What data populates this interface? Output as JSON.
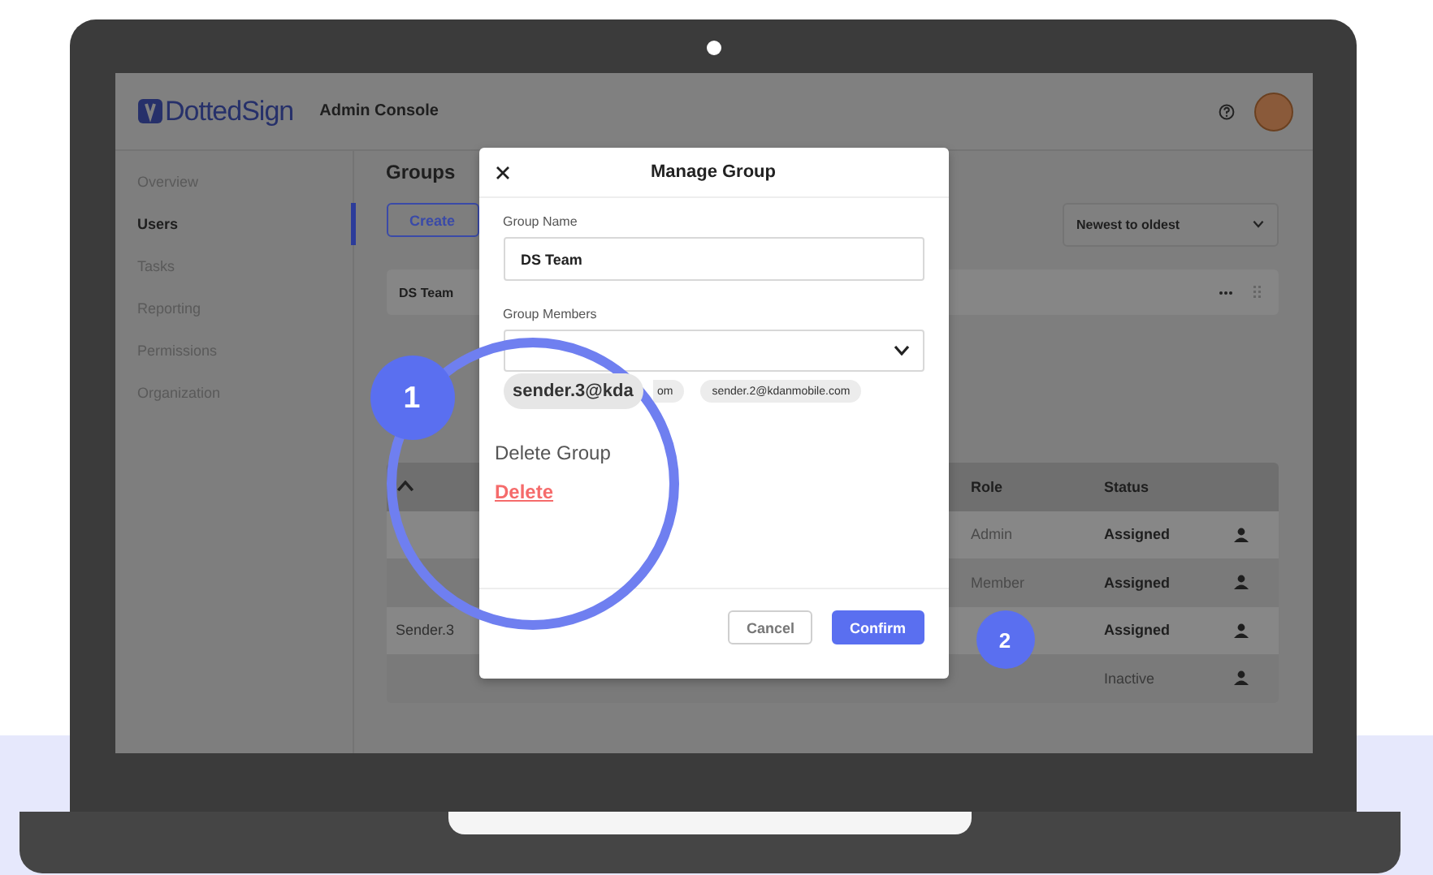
{
  "header": {
    "logo": "DottedSign",
    "title": "Admin Console"
  },
  "sidebar": {
    "items": [
      {
        "label": "Overview",
        "selected": false
      },
      {
        "label": "Users",
        "selected": true
      },
      {
        "label": "Tasks",
        "selected": false
      },
      {
        "label": "Reporting",
        "selected": false
      },
      {
        "label": "Permissions",
        "selected": false
      },
      {
        "label": "Organization",
        "selected": false
      }
    ]
  },
  "page": {
    "title": "Groups",
    "create_button": "Create",
    "sort": "Newest to oldest",
    "groups": [
      {
        "name": "DS Team"
      }
    ]
  },
  "table": {
    "columns": [
      "Role",
      "Status"
    ],
    "rows": [
      {
        "role": "Admin",
        "status": "Assigned",
        "kind": "assigned"
      },
      {
        "role": "Member",
        "status": "Assigned",
        "kind": "assigned"
      },
      {
        "name": "Sender.3",
        "status": "Assigned",
        "kind": "assigned"
      },
      {
        "status": "Inactive",
        "kind": "inactive"
      }
    ]
  },
  "modal": {
    "title": "Manage Group",
    "name_label": "Group Name",
    "name_value": "DS Team",
    "members_label": "Group Members",
    "chips": [
      {
        "text": "om"
      },
      {
        "text": "sender.2@kdanmobile.com"
      }
    ],
    "magnified_chip": "sender.3@kda",
    "delete_label": "Delete Group",
    "delete_link": "Delete",
    "buttons": [
      {
        "label": "Cancel",
        "kind": "secondary"
      },
      {
        "label": "Confirm",
        "kind": "primary"
      }
    ]
  },
  "callouts": [
    {
      "label": "1"
    },
    {
      "label": "2"
    }
  ]
}
